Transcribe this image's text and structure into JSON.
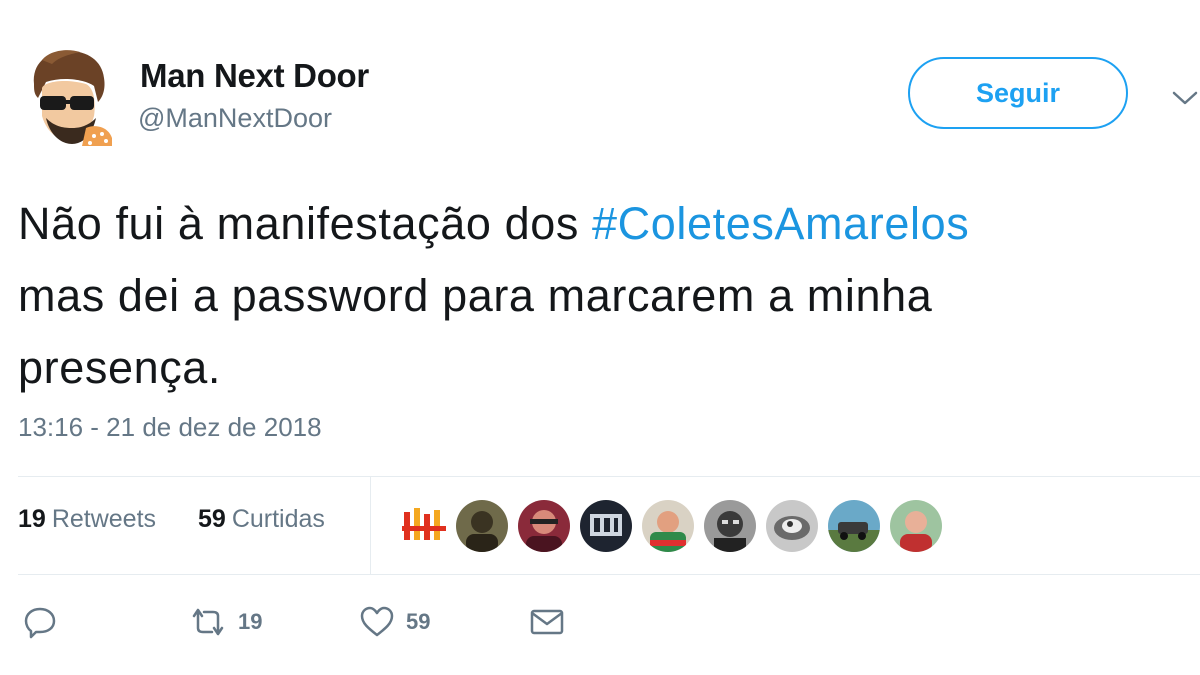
{
  "author": {
    "name": "Man Next Door",
    "handle": "@ManNextDoor"
  },
  "follow_button": {
    "label": "Seguir"
  },
  "tweet": {
    "line1_prefix": "Não fui à manifestação dos ",
    "hashtag": "#ColetesAmarelos",
    "line2": "mas dei a password para marcarem a minha",
    "line3": "presença.",
    "timestamp": "13:16 - 21 de dez de 2018"
  },
  "stats": {
    "retweets_count": "19",
    "retweets_label": "Retweets",
    "likes_count": "59",
    "likes_label": "Curtidas"
  },
  "likers": [
    "liker-avatar-1",
    "liker-avatar-2",
    "liker-avatar-3",
    "liker-avatar-4",
    "liker-avatar-5",
    "liker-avatar-6",
    "liker-avatar-7",
    "liker-avatar-8",
    "liker-avatar-9"
  ],
  "actions": {
    "reply_icon": "reply-icon",
    "retweet_icon": "retweet-icon",
    "retweet_count": "19",
    "like_icon": "heart-icon",
    "like_count": "59",
    "dm_icon": "envelope-icon"
  },
  "colors": {
    "accent": "#1da1f2",
    "hashtag": "#1b95e0",
    "secondary_text": "#657786",
    "divider": "#e6ecf0"
  }
}
